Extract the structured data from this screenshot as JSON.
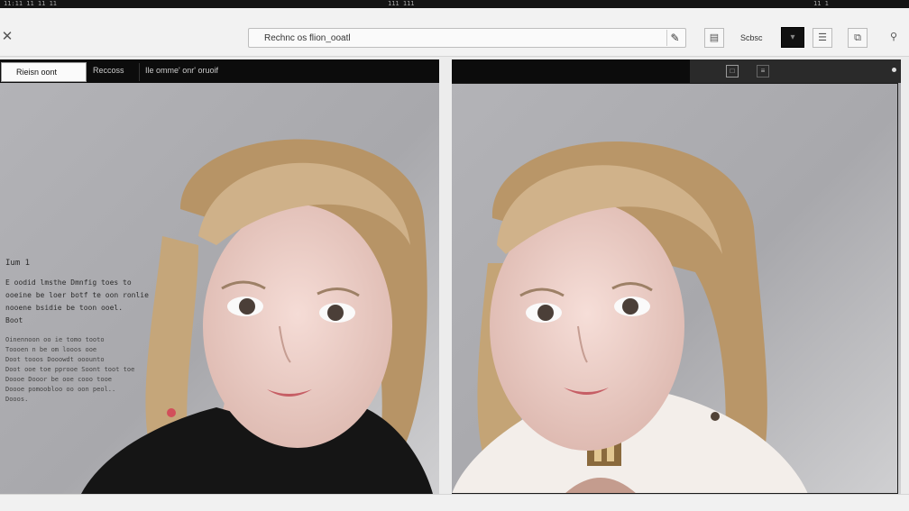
{
  "topbar": {
    "left_text": "11:11 11 11 11",
    "mid_text": "111 111",
    "right_text": "11 1"
  },
  "toolbar": {
    "close_icon": "close-icon",
    "search_text": "Rechnc os flion_ooatl",
    "label": "Scbsc",
    "swatch_color": "#111111"
  },
  "left_pane": {
    "tabs": [
      {
        "label": "Rieisn oont",
        "active": true
      },
      {
        "label": "Reccoss"
      },
      {
        "label": "Ile omme' onr' oruoif"
      }
    ],
    "text_blocks": {
      "title": "Ium 1",
      "lines": [
        "E oodid lmsthe Dmnfig toes to",
        "ooeine be loer botf te oon ronlie",
        "nooene bsidie be toon ooel.",
        "Boot"
      ],
      "paragraph": [
        "Oinennoon oo ie tomo tooto",
        "Toooen n be om looos ooe",
        "Doot tooos Dooowdt ooounto",
        "Doot ooe toe pprooe Soont toot toe",
        "Doooe Dooor be ooe cooo tooe",
        "Doooe pomoobloo oo oon peol..",
        "Dooos."
      ]
    }
  },
  "right_pane": {
    "tool_icons": [
      "square-icon",
      "document-icon"
    ]
  },
  "colors": {
    "toolbar_bg": "#f2f2f2",
    "pane_header": "#0c0c0c",
    "accent": "#111111"
  }
}
